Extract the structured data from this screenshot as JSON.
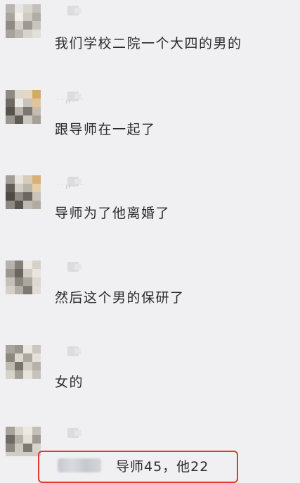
{
  "messages": [
    {
      "text": "我们学校二院一个大四的男的",
      "name_hint": ""
    },
    {
      "text": "跟导师在一起了",
      "name_hint": "′′≀≀ ′′"
    },
    {
      "text": "导师为了他离婚了",
      "name_hint": "′′≀≀ ′′"
    },
    {
      "text": "然后这个男的保研了",
      "name_hint": ""
    },
    {
      "text": "女的",
      "name_hint": ""
    }
  ],
  "highlighted_reply": {
    "text": "导师45，他22"
  },
  "colors": {
    "highlight_border": "#e23a2e",
    "background": "#f0f0f2",
    "text": "#2a2a2a"
  }
}
